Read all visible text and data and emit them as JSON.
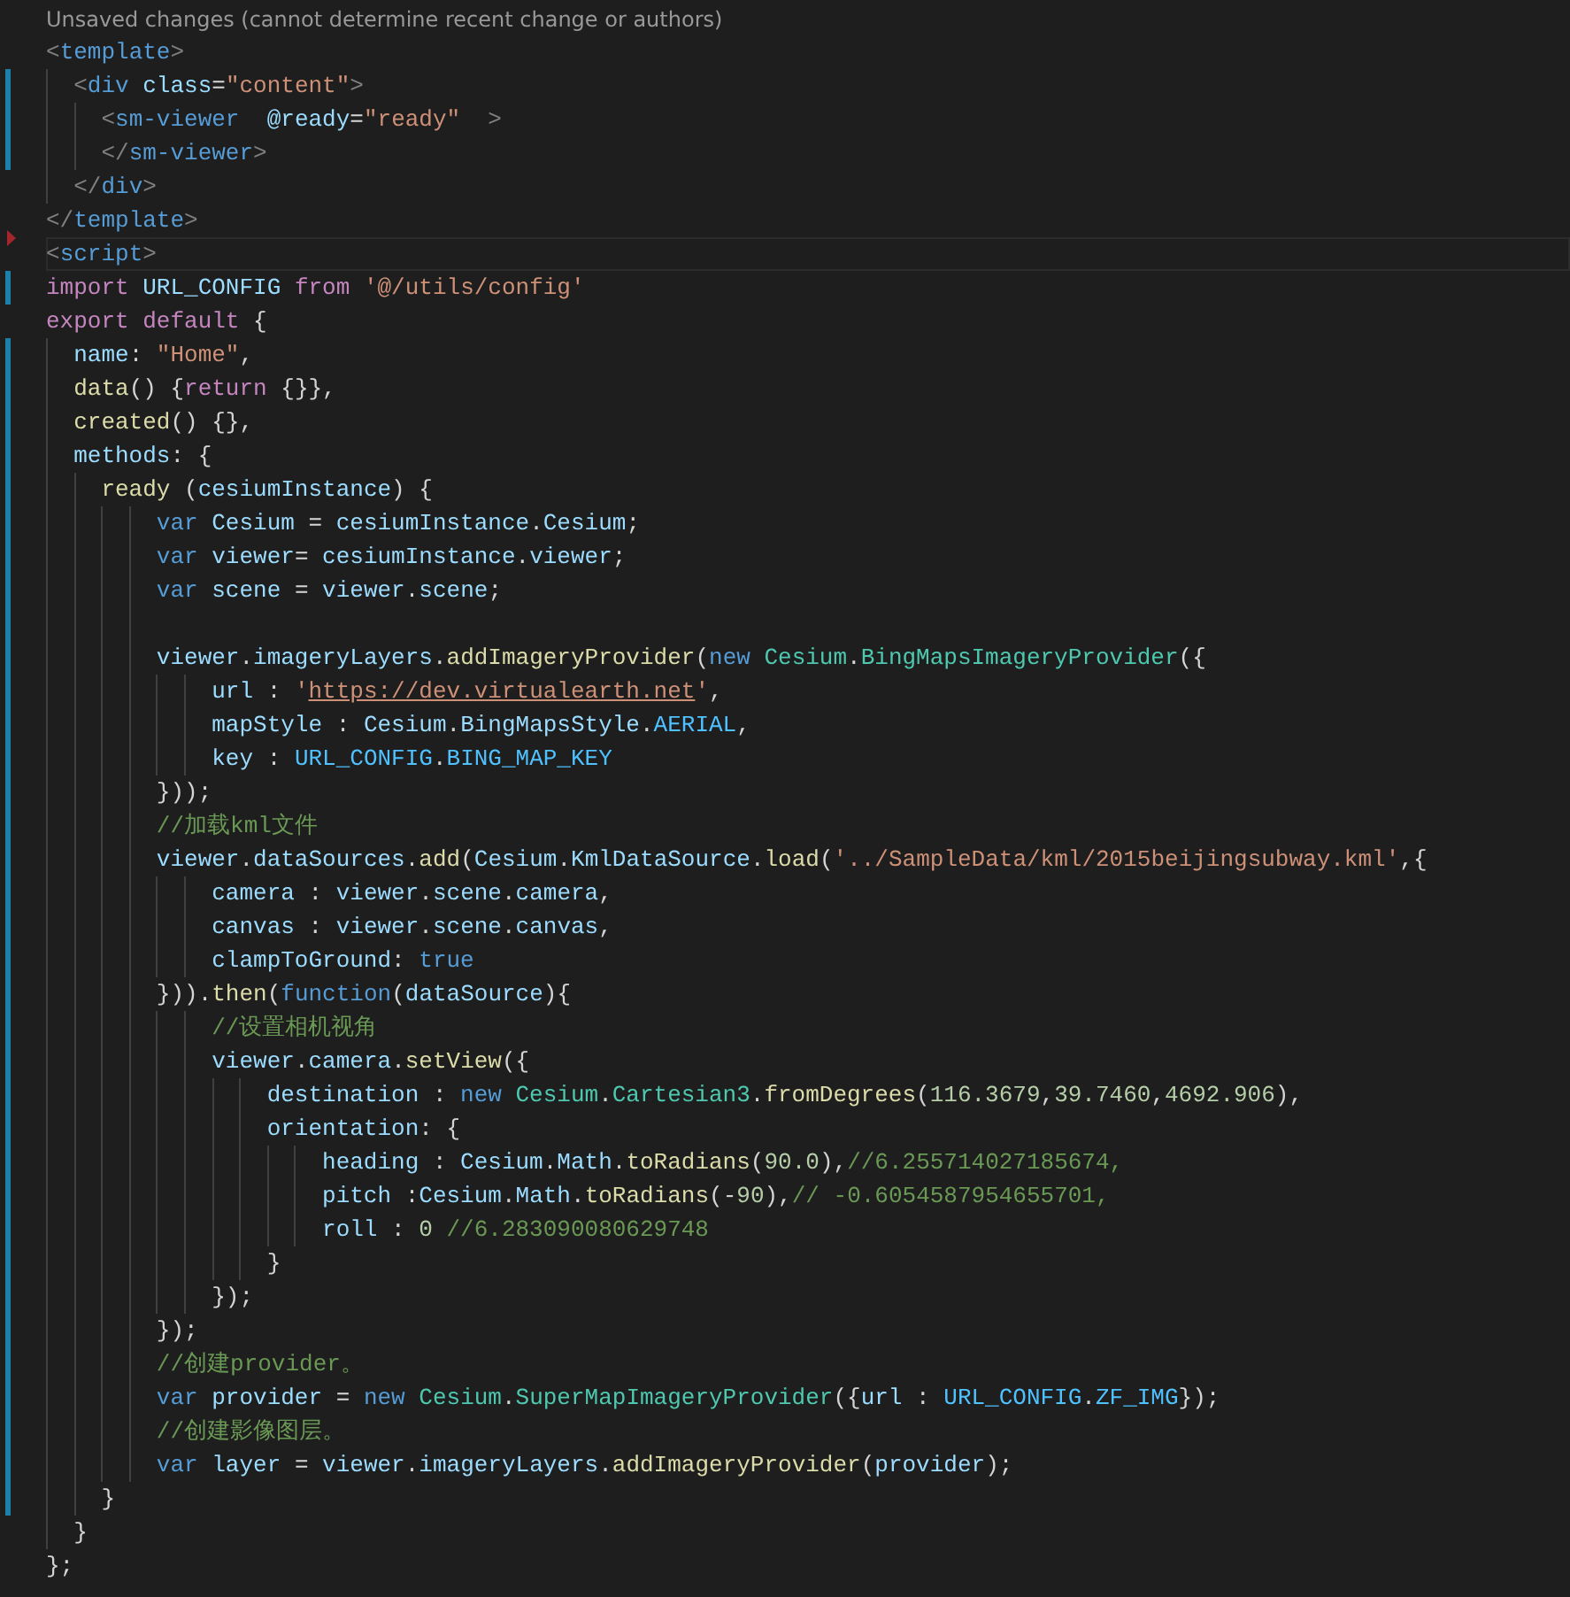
{
  "blame_hint": "Unsaved changes (cannot determine recent change or authors)",
  "lines": [
    {
      "changed": false,
      "deleted_above": false,
      "current": false,
      "tokens": [
        {
          "kind": "bracket",
          "text": "<"
        },
        {
          "kind": "tag",
          "text": "template"
        },
        {
          "kind": "bracket",
          "text": ">"
        }
      ]
    },
    {
      "changed": true,
      "deleted_above": false,
      "current": false,
      "tokens": [
        {
          "kind": "bracket",
          "text": "  <"
        },
        {
          "kind": "tag",
          "text": "div"
        },
        {
          "kind": "attribute",
          "text": " class"
        },
        {
          "kind": "plain",
          "text": "="
        },
        {
          "kind": "string",
          "text": "\"content\""
        },
        {
          "kind": "bracket",
          "text": ">"
        }
      ]
    },
    {
      "changed": true,
      "deleted_above": false,
      "current": false,
      "tokens": [
        {
          "kind": "bracket",
          "text": "    <"
        },
        {
          "kind": "tag",
          "text": "sm-viewer"
        },
        {
          "kind": "attribute",
          "text": "  @ready"
        },
        {
          "kind": "plain",
          "text": "="
        },
        {
          "kind": "string",
          "text": "\"ready\""
        },
        {
          "kind": "bracket",
          "text": "  >"
        }
      ]
    },
    {
      "changed": true,
      "deleted_above": false,
      "current": false,
      "tokens": [
        {
          "kind": "bracket",
          "text": "    </"
        },
        {
          "kind": "tag",
          "text": "sm-viewer"
        },
        {
          "kind": "bracket",
          "text": ">"
        }
      ]
    },
    {
      "changed": false,
      "deleted_above": false,
      "current": false,
      "tokens": [
        {
          "kind": "bracket",
          "text": "  </"
        },
        {
          "kind": "tag",
          "text": "div"
        },
        {
          "kind": "bracket",
          "text": ">"
        }
      ]
    },
    {
      "changed": false,
      "deleted_above": false,
      "current": false,
      "tokens": [
        {
          "kind": "bracket",
          "text": "</"
        },
        {
          "kind": "tag",
          "text": "template"
        },
        {
          "kind": "bracket",
          "text": ">"
        }
      ]
    },
    {
      "changed": false,
      "deleted_above": true,
      "current": true,
      "tokens": [
        {
          "kind": "bracket",
          "text": "<"
        },
        {
          "kind": "tag",
          "text": "script"
        },
        {
          "kind": "bracket",
          "text": ">"
        }
      ]
    },
    {
      "changed": true,
      "deleted_above": false,
      "current": false,
      "tokens": [
        {
          "kind": "control",
          "text": "import"
        },
        {
          "kind": "variable",
          "text": " URL_CONFIG "
        },
        {
          "kind": "control",
          "text": "from"
        },
        {
          "kind": "string",
          "text": " '@/utils/config'"
        }
      ]
    },
    {
      "changed": false,
      "deleted_above": false,
      "current": false,
      "tokens": [
        {
          "kind": "control",
          "text": "export default"
        },
        {
          "kind": "plain",
          "text": " {"
        }
      ]
    },
    {
      "changed": true,
      "deleted_above": false,
      "current": false,
      "tokens": [
        {
          "kind": "variable",
          "text": "  name"
        },
        {
          "kind": "plain",
          "text": ": "
        },
        {
          "kind": "string",
          "text": "\"Home\""
        },
        {
          "kind": "plain",
          "text": ","
        }
      ]
    },
    {
      "changed": true,
      "deleted_above": false,
      "current": false,
      "tokens": [
        {
          "kind": "function",
          "text": "  data"
        },
        {
          "kind": "plain",
          "text": "() {"
        },
        {
          "kind": "control",
          "text": "return"
        },
        {
          "kind": "plain",
          "text": " {}},"
        }
      ]
    },
    {
      "changed": true,
      "deleted_above": false,
      "current": false,
      "tokens": [
        {
          "kind": "function",
          "text": "  created"
        },
        {
          "kind": "plain",
          "text": "() {},"
        }
      ]
    },
    {
      "changed": true,
      "deleted_above": false,
      "current": false,
      "tokens": [
        {
          "kind": "variable",
          "text": "  methods"
        },
        {
          "kind": "plain",
          "text": ": {"
        }
      ]
    },
    {
      "changed": true,
      "deleted_above": false,
      "current": false,
      "tokens": [
        {
          "kind": "function",
          "text": "    ready"
        },
        {
          "kind": "plain",
          "text": " ("
        },
        {
          "kind": "variable",
          "text": "cesiumInstance"
        },
        {
          "kind": "plain",
          "text": ") {"
        }
      ]
    },
    {
      "changed": true,
      "deleted_above": false,
      "current": false,
      "tokens": [
        {
          "kind": "keyword",
          "text": "        var"
        },
        {
          "kind": "variable",
          "text": " Cesium"
        },
        {
          "kind": "plain",
          "text": " = "
        },
        {
          "kind": "variable",
          "text": "cesiumInstance"
        },
        {
          "kind": "plain",
          "text": "."
        },
        {
          "kind": "variable",
          "text": "Cesium"
        },
        {
          "kind": "plain",
          "text": ";"
        }
      ]
    },
    {
      "changed": true,
      "deleted_above": false,
      "current": false,
      "tokens": [
        {
          "kind": "keyword",
          "text": "        var"
        },
        {
          "kind": "variable",
          "text": " viewer"
        },
        {
          "kind": "plain",
          "text": "= "
        },
        {
          "kind": "variable",
          "text": "cesiumInstance"
        },
        {
          "kind": "plain",
          "text": "."
        },
        {
          "kind": "variable",
          "text": "viewer"
        },
        {
          "kind": "plain",
          "text": ";"
        }
      ]
    },
    {
      "changed": true,
      "deleted_above": false,
      "current": false,
      "tokens": [
        {
          "kind": "keyword",
          "text": "        var"
        },
        {
          "kind": "variable",
          "text": " scene"
        },
        {
          "kind": "plain",
          "text": " = "
        },
        {
          "kind": "variable",
          "text": "viewer"
        },
        {
          "kind": "plain",
          "text": "."
        },
        {
          "kind": "variable",
          "text": "scene"
        },
        {
          "kind": "plain",
          "text": ";"
        }
      ]
    },
    {
      "changed": true,
      "deleted_above": false,
      "current": false
    },
    {
      "changed": true,
      "deleted_above": false,
      "current": false,
      "tokens": [
        {
          "kind": "variable",
          "text": "        viewer"
        },
        {
          "kind": "plain",
          "text": "."
        },
        {
          "kind": "variable",
          "text": "imageryLayers"
        },
        {
          "kind": "plain",
          "text": "."
        },
        {
          "kind": "function",
          "text": "addImageryProvider"
        },
        {
          "kind": "plain",
          "text": "("
        },
        {
          "kind": "keyword",
          "text": "new"
        },
        {
          "kind": "class",
          "text": " Cesium"
        },
        {
          "kind": "plain",
          "text": "."
        },
        {
          "kind": "class",
          "text": "BingMapsImageryProvider"
        },
        {
          "kind": "plain",
          "text": "({"
        }
      ]
    },
    {
      "changed": true,
      "deleted_above": false,
      "current": false,
      "tokens": [
        {
          "kind": "variable",
          "text": "            url"
        },
        {
          "kind": "plain",
          "text": " : "
        },
        {
          "kind": "string",
          "text": "'"
        },
        {
          "kind": "link",
          "text": "https://dev.virtualearth.net"
        },
        {
          "kind": "string",
          "text": "'"
        },
        {
          "kind": "plain",
          "text": ","
        }
      ]
    },
    {
      "changed": true,
      "deleted_above": false,
      "current": false,
      "tokens": [
        {
          "kind": "variable",
          "text": "            mapStyle"
        },
        {
          "kind": "plain",
          "text": " : "
        },
        {
          "kind": "variable",
          "text": "Cesium"
        },
        {
          "kind": "plain",
          "text": "."
        },
        {
          "kind": "variable",
          "text": "BingMapsStyle"
        },
        {
          "kind": "plain",
          "text": "."
        },
        {
          "kind": "constant",
          "text": "AERIAL"
        },
        {
          "kind": "plain",
          "text": ","
        }
      ]
    },
    {
      "changed": true,
      "deleted_above": false,
      "current": false,
      "tokens": [
        {
          "kind": "variable",
          "text": "            key"
        },
        {
          "kind": "plain",
          "text": " : "
        },
        {
          "kind": "constant",
          "text": "URL_CONFIG"
        },
        {
          "kind": "plain",
          "text": "."
        },
        {
          "kind": "constant",
          "text": "BING_MAP_KEY"
        }
      ]
    },
    {
      "changed": true,
      "deleted_above": false,
      "current": false,
      "tokens": [
        {
          "kind": "plain",
          "text": "        }));"
        }
      ]
    },
    {
      "changed": true,
      "deleted_above": false,
      "current": false,
      "tokens": [
        {
          "kind": "comment",
          "text": "        //加载kml文件"
        }
      ]
    },
    {
      "changed": true,
      "deleted_above": false,
      "current": false,
      "tokens": [
        {
          "kind": "variable",
          "text": "        viewer"
        },
        {
          "kind": "plain",
          "text": "."
        },
        {
          "kind": "variable",
          "text": "dataSources"
        },
        {
          "kind": "plain",
          "text": "."
        },
        {
          "kind": "function",
          "text": "add"
        },
        {
          "kind": "plain",
          "text": "("
        },
        {
          "kind": "variable",
          "text": "Cesium"
        },
        {
          "kind": "plain",
          "text": "."
        },
        {
          "kind": "variable",
          "text": "KmlDataSource"
        },
        {
          "kind": "plain",
          "text": "."
        },
        {
          "kind": "function",
          "text": "load"
        },
        {
          "kind": "plain",
          "text": "("
        },
        {
          "kind": "string",
          "text": "'../SampleData/kml/2015beijingsubway.kml'"
        },
        {
          "kind": "plain",
          "text": ",{"
        }
      ]
    },
    {
      "changed": true,
      "deleted_above": false,
      "current": false,
      "tokens": [
        {
          "kind": "variable",
          "text": "            camera"
        },
        {
          "kind": "plain",
          "text": " : "
        },
        {
          "kind": "variable",
          "text": "viewer"
        },
        {
          "kind": "plain",
          "text": "."
        },
        {
          "kind": "variable",
          "text": "scene"
        },
        {
          "kind": "plain",
          "text": "."
        },
        {
          "kind": "variable",
          "text": "camera"
        },
        {
          "kind": "plain",
          "text": ","
        }
      ]
    },
    {
      "changed": true,
      "deleted_above": false,
      "current": false,
      "tokens": [
        {
          "kind": "variable",
          "text": "            canvas"
        },
        {
          "kind": "plain",
          "text": " : "
        },
        {
          "kind": "variable",
          "text": "viewer"
        },
        {
          "kind": "plain",
          "text": "."
        },
        {
          "kind": "variable",
          "text": "scene"
        },
        {
          "kind": "plain",
          "text": "."
        },
        {
          "kind": "variable",
          "text": "canvas"
        },
        {
          "kind": "plain",
          "text": ","
        }
      ]
    },
    {
      "changed": true,
      "deleted_above": false,
      "current": false,
      "tokens": [
        {
          "kind": "variable",
          "text": "            clampToGround"
        },
        {
          "kind": "plain",
          "text": ": "
        },
        {
          "kind": "keyword",
          "text": "true"
        }
      ]
    },
    {
      "changed": true,
      "deleted_above": false,
      "current": false,
      "tokens": [
        {
          "kind": "plain",
          "text": "        }))."
        },
        {
          "kind": "function",
          "text": "then"
        },
        {
          "kind": "plain",
          "text": "("
        },
        {
          "kind": "keyword",
          "text": "function"
        },
        {
          "kind": "plain",
          "text": "("
        },
        {
          "kind": "variable",
          "text": "dataSource"
        },
        {
          "kind": "plain",
          "text": "){"
        }
      ]
    },
    {
      "changed": true,
      "deleted_above": false,
      "current": false,
      "tokens": [
        {
          "kind": "comment",
          "text": "            //设置相机视角"
        }
      ]
    },
    {
      "changed": true,
      "deleted_above": false,
      "current": false,
      "tokens": [
        {
          "kind": "variable",
          "text": "            viewer"
        },
        {
          "kind": "plain",
          "text": "."
        },
        {
          "kind": "variable",
          "text": "camera"
        },
        {
          "kind": "plain",
          "text": "."
        },
        {
          "kind": "function",
          "text": "setView"
        },
        {
          "kind": "plain",
          "text": "({"
        }
      ]
    },
    {
      "changed": true,
      "deleted_above": false,
      "current": false,
      "tokens": [
        {
          "kind": "variable",
          "text": "                destination"
        },
        {
          "kind": "plain",
          "text": " : "
        },
        {
          "kind": "keyword",
          "text": "new"
        },
        {
          "kind": "class",
          "text": " Cesium"
        },
        {
          "kind": "plain",
          "text": "."
        },
        {
          "kind": "class",
          "text": "Cartesian3"
        },
        {
          "kind": "plain",
          "text": "."
        },
        {
          "kind": "function",
          "text": "fromDegrees"
        },
        {
          "kind": "plain",
          "text": "("
        },
        {
          "kind": "number",
          "text": "116.3679"
        },
        {
          "kind": "plain",
          "text": ","
        },
        {
          "kind": "number",
          "text": "39.7460"
        },
        {
          "kind": "plain",
          "text": ","
        },
        {
          "kind": "number",
          "text": "4692.906"
        },
        {
          "kind": "plain",
          "text": "),"
        }
      ]
    },
    {
      "changed": true,
      "deleted_above": false,
      "current": false,
      "tokens": [
        {
          "kind": "variable",
          "text": "                orientation"
        },
        {
          "kind": "plain",
          "text": ": {"
        }
      ]
    },
    {
      "changed": true,
      "deleted_above": false,
      "current": false,
      "tokens": [
        {
          "kind": "variable",
          "text": "                    heading"
        },
        {
          "kind": "plain",
          "text": " : "
        },
        {
          "kind": "variable",
          "text": "Cesium"
        },
        {
          "kind": "plain",
          "text": "."
        },
        {
          "kind": "variable",
          "text": "Math"
        },
        {
          "kind": "plain",
          "text": "."
        },
        {
          "kind": "function",
          "text": "toRadians"
        },
        {
          "kind": "plain",
          "text": "("
        },
        {
          "kind": "number",
          "text": "90.0"
        },
        {
          "kind": "plain",
          "text": "),"
        },
        {
          "kind": "comment",
          "text": "//6.255714027185674,"
        }
      ]
    },
    {
      "changed": true,
      "deleted_above": false,
      "current": false,
      "tokens": [
        {
          "kind": "variable",
          "text": "                    pitch"
        },
        {
          "kind": "plain",
          "text": " :"
        },
        {
          "kind": "variable",
          "text": "Cesium"
        },
        {
          "kind": "plain",
          "text": "."
        },
        {
          "kind": "variable",
          "text": "Math"
        },
        {
          "kind": "plain",
          "text": "."
        },
        {
          "kind": "function",
          "text": "toRadians"
        },
        {
          "kind": "plain",
          "text": "(-"
        },
        {
          "kind": "number",
          "text": "90"
        },
        {
          "kind": "plain",
          "text": "),"
        },
        {
          "kind": "comment",
          "text": "// -0.6054587954655701,"
        }
      ]
    },
    {
      "changed": true,
      "deleted_above": false,
      "current": false,
      "tokens": [
        {
          "kind": "variable",
          "text": "                    roll"
        },
        {
          "kind": "plain",
          "text": " : "
        },
        {
          "kind": "number",
          "text": "0"
        },
        {
          "kind": "comment",
          "text": " //6.283090080629748"
        }
      ]
    },
    {
      "changed": true,
      "deleted_above": false,
      "current": false,
      "tokens": [
        {
          "kind": "plain",
          "text": "                }"
        }
      ]
    },
    {
      "changed": true,
      "deleted_above": false,
      "current": false,
      "tokens": [
        {
          "kind": "plain",
          "text": "            });"
        }
      ]
    },
    {
      "changed": true,
      "deleted_above": false,
      "current": false,
      "tokens": [
        {
          "kind": "plain",
          "text": "        });"
        }
      ]
    },
    {
      "changed": true,
      "deleted_above": false,
      "current": false,
      "tokens": [
        {
          "kind": "comment",
          "text": "        //创建provider。"
        }
      ]
    },
    {
      "changed": true,
      "deleted_above": false,
      "current": false,
      "tokens": [
        {
          "kind": "keyword",
          "text": "        var"
        },
        {
          "kind": "variable",
          "text": " provider"
        },
        {
          "kind": "plain",
          "text": " = "
        },
        {
          "kind": "keyword",
          "text": "new"
        },
        {
          "kind": "class",
          "text": " Cesium"
        },
        {
          "kind": "plain",
          "text": "."
        },
        {
          "kind": "class",
          "text": "SuperMapImageryProvider"
        },
        {
          "kind": "plain",
          "text": "({"
        },
        {
          "kind": "variable",
          "text": "url"
        },
        {
          "kind": "plain",
          "text": " : "
        },
        {
          "kind": "constant",
          "text": "URL_CONFIG"
        },
        {
          "kind": "plain",
          "text": "."
        },
        {
          "kind": "constant",
          "text": "ZF_IMG"
        },
        {
          "kind": "plain",
          "text": "});"
        }
      ]
    },
    {
      "changed": true,
      "deleted_above": false,
      "current": false,
      "tokens": [
        {
          "kind": "comment",
          "text": "        //创建影像图层。"
        }
      ]
    },
    {
      "changed": true,
      "deleted_above": false,
      "current": false,
      "tokens": [
        {
          "kind": "keyword",
          "text": "        var"
        },
        {
          "kind": "variable",
          "text": " layer"
        },
        {
          "kind": "plain",
          "text": " = "
        },
        {
          "kind": "variable",
          "text": "viewer"
        },
        {
          "kind": "plain",
          "text": "."
        },
        {
          "kind": "variable",
          "text": "imageryLayers"
        },
        {
          "kind": "plain",
          "text": "."
        },
        {
          "kind": "function",
          "text": "addImageryProvider"
        },
        {
          "kind": "plain",
          "text": "("
        },
        {
          "kind": "variable",
          "text": "provider"
        },
        {
          "kind": "plain",
          "text": ");"
        }
      ]
    },
    {
      "changed": true,
      "deleted_above": false,
      "current": false,
      "tokens": [
        {
          "kind": "plain",
          "text": "    }"
        }
      ]
    },
    {
      "changed": false,
      "deleted_above": false,
      "current": false,
      "tokens": [
        {
          "kind": "plain",
          "text": "  }"
        }
      ]
    },
    {
      "changed": false,
      "deleted_above": false,
      "current": false,
      "tokens": [
        {
          "kind": "plain",
          "text": "};"
        }
      ]
    }
  ]
}
